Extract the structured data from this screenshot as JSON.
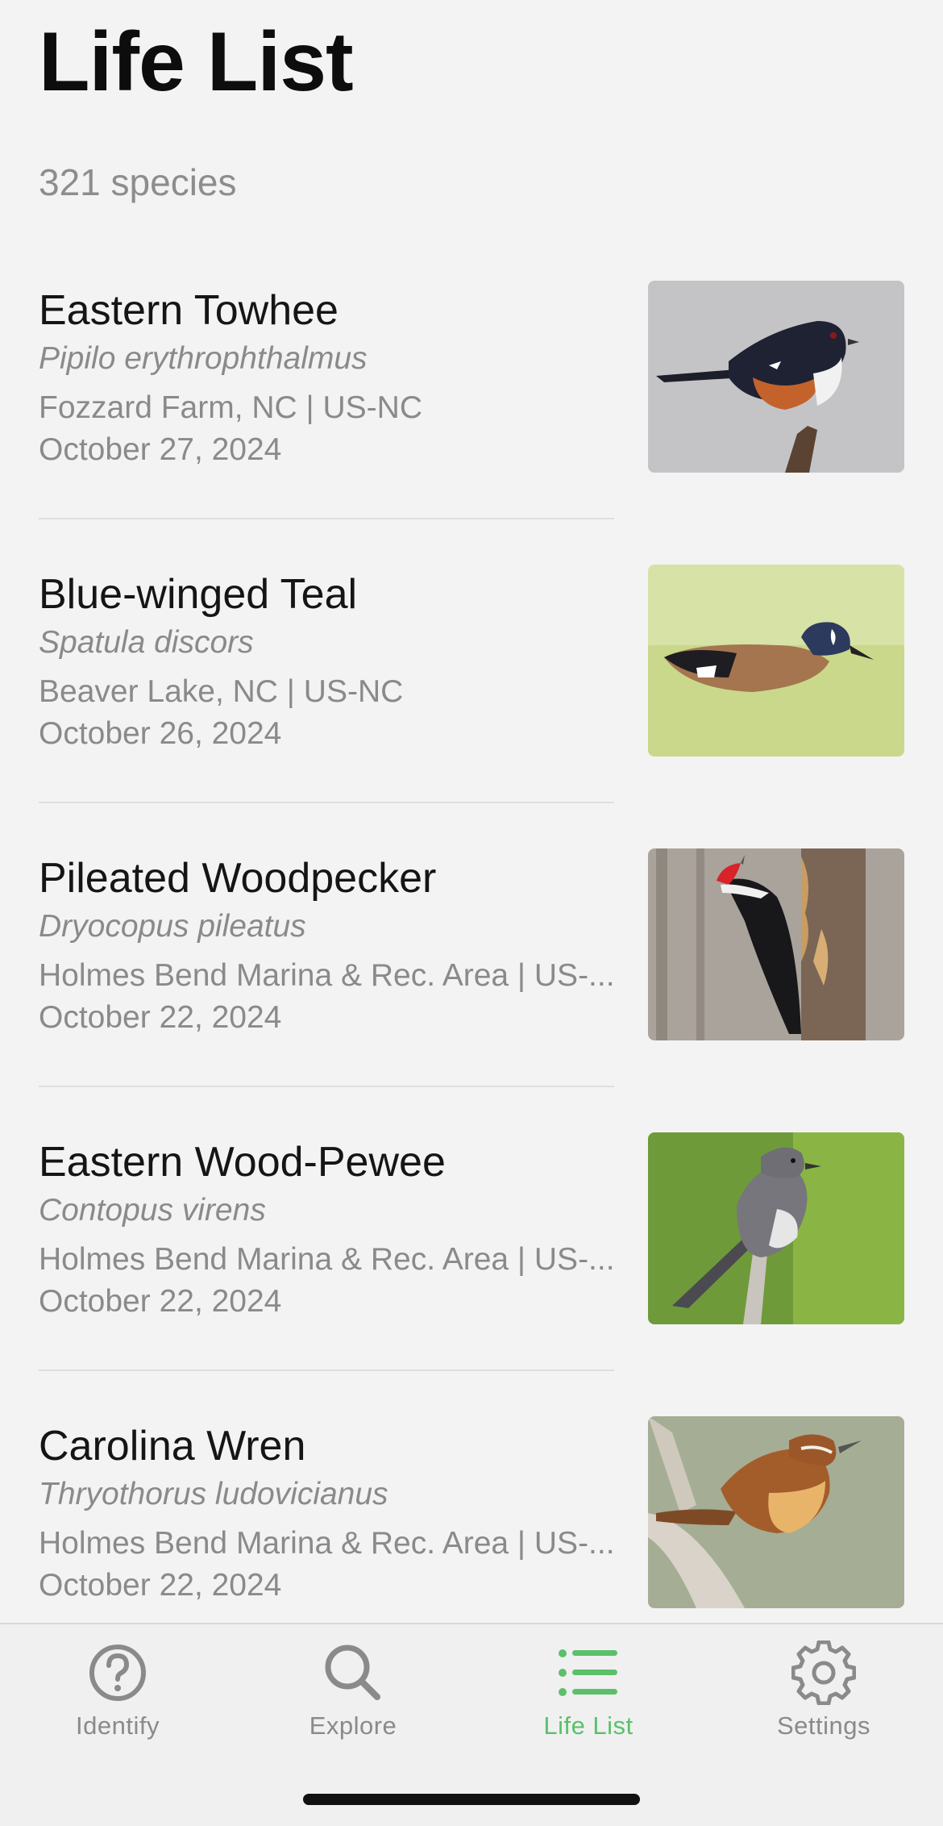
{
  "header": {
    "title": "Life List",
    "count": "321 species"
  },
  "entries": [
    {
      "common_name": "Eastern Towhee",
      "scientific_name": "Pipilo erythrophthalmus",
      "location": "Fozzard Farm, NC | US-NC",
      "date": "October 27, 2024"
    },
    {
      "common_name": "Blue-winged Teal",
      "scientific_name": "Spatula discors",
      "location": "Beaver Lake, NC | US-NC",
      "date": "October 26, 2024"
    },
    {
      "common_name": "Pileated Woodpecker",
      "scientific_name": "Dryocopus pileatus",
      "location": "Holmes Bend Marina & Rec. Area | US-...",
      "date": "October 22, 2024"
    },
    {
      "common_name": "Eastern Wood-Pewee",
      "scientific_name": "Contopus virens",
      "location": "Holmes Bend Marina & Rec. Area | US-...",
      "date": "October 22, 2024"
    },
    {
      "common_name": "Carolina Wren",
      "scientific_name": "Thryothorus ludovicianus",
      "location": "Holmes Bend Marina & Rec. Area | US-...",
      "date": "October 22, 2024"
    }
  ],
  "tabs": [
    {
      "label": "Identify",
      "icon": "question-circle-icon",
      "active": false
    },
    {
      "label": "Explore",
      "icon": "search-icon",
      "active": false
    },
    {
      "label": "Life List",
      "icon": "list-icon",
      "active": true
    },
    {
      "label": "Settings",
      "icon": "gear-icon",
      "active": false
    }
  ],
  "colors": {
    "accent": "#5cc06b",
    "inactive_tab": "#8a8a8a",
    "secondary_text": "#8a8a8a",
    "background": "#f3f3f3"
  }
}
